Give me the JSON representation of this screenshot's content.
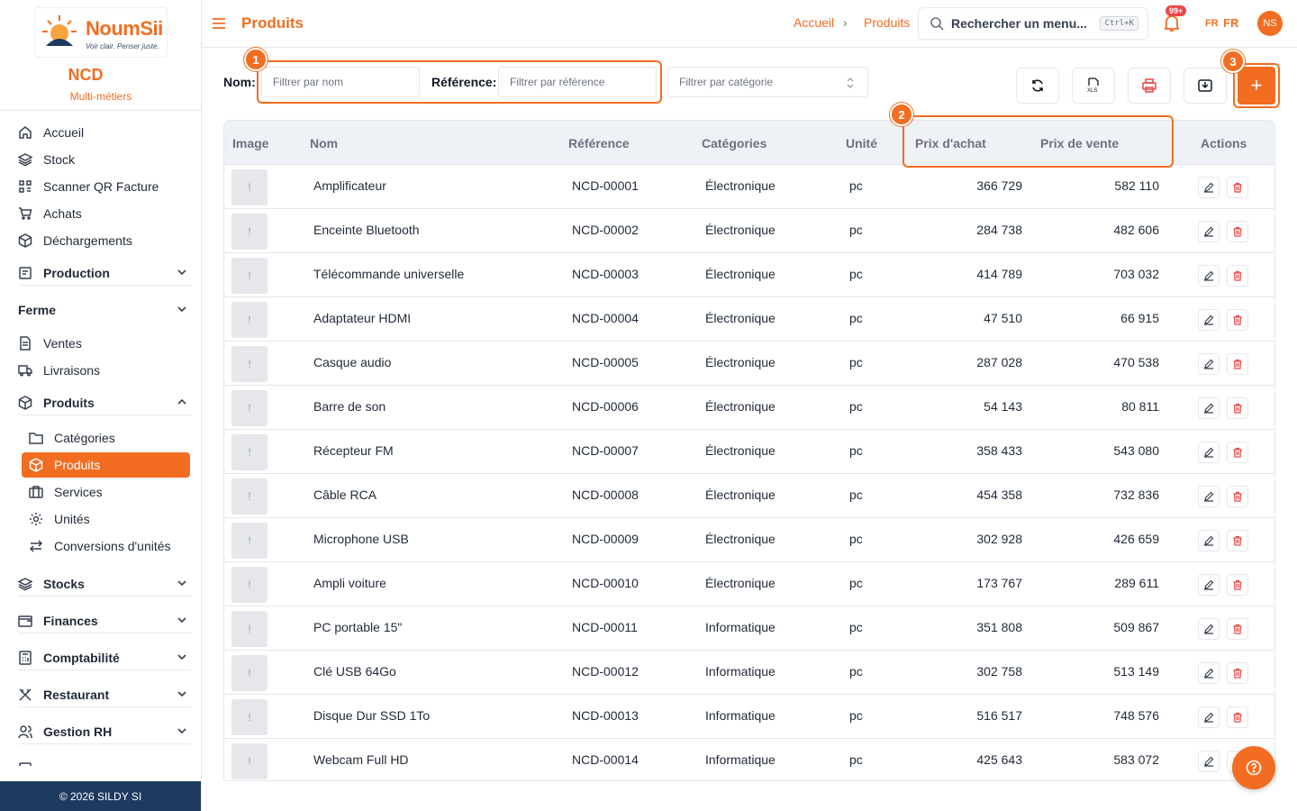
{
  "brand": {
    "logo_name": "NoumSii",
    "logo_tagline": "Voir clair. Penser juste.",
    "org_name": "NCD",
    "org_subtitle": "Multi-métiers",
    "accent_color": "#f26d21",
    "footer_bg": "#1e3a5f"
  },
  "sidebar": {
    "items": [
      {
        "label": "Accueil",
        "icon": "home-icon"
      },
      {
        "label": "Stock",
        "icon": "layers-icon"
      },
      {
        "label": "Scanner QR Facture",
        "icon": "qr-icon"
      },
      {
        "label": "Achats",
        "icon": "cart-icon"
      },
      {
        "label": "Déchargements",
        "icon": "box-icon"
      }
    ],
    "group_production": "Production",
    "group_ferme": "Ferme",
    "item_ventes": "Ventes",
    "item_livraisons": "Livraisons",
    "group_produits": "Produits",
    "sub_items": [
      {
        "label": "Catégories",
        "icon": "folder-icon"
      },
      {
        "label": "Produits",
        "icon": "box-icon",
        "active": true
      },
      {
        "label": "Services",
        "icon": "briefcase-icon"
      },
      {
        "label": "Unités",
        "icon": "gear-icon"
      },
      {
        "label": "Conversions d'unités",
        "icon": "swap-icon"
      }
    ],
    "groups_bottom": [
      "Stocks",
      "Finances",
      "Comptabilité",
      "Restaurant",
      "Gestion RH"
    ],
    "footer": "© 2026 SILDY SI"
  },
  "header": {
    "title": "Produits",
    "breadcrumb_home": "Accueil",
    "breadcrumb_sep": "›",
    "breadcrumb_current": "Produits",
    "search_placeholder": "Rechercher un menu...",
    "search_shortcut": "Ctrl+K",
    "notif_badge": "99+",
    "lang_flag": "FR",
    "lang": "FR",
    "avatar_initials": "NS"
  },
  "filters": {
    "name_label": "Nom:",
    "name_placeholder": "Filtrer par nom",
    "ref_label": "Référence:",
    "ref_placeholder": "Filtrer par référence",
    "category_placeholder": "Filtrer par catégorie"
  },
  "toolbar": {
    "add_label": "+"
  },
  "annotations": {
    "one": "1",
    "two": "2",
    "three": "3"
  },
  "table": {
    "headers": {
      "image": "Image",
      "name": "Nom",
      "reference": "Référence",
      "category": "Catégories",
      "unit": "Unité",
      "purchase": "Prix d'achat",
      "sale": "Prix de vente",
      "actions": "Actions"
    },
    "image_placeholder": "!",
    "rows": [
      {
        "name": "Amplificateur",
        "ref": "NCD-00001",
        "cat": "Électronique",
        "unit": "pc",
        "purchase": "366 729",
        "sale": "582 110"
      },
      {
        "name": "Enceinte Bluetooth",
        "ref": "NCD-00002",
        "cat": "Électronique",
        "unit": "pc",
        "purchase": "284 738",
        "sale": "482 606"
      },
      {
        "name": "Télécommande universelle",
        "ref": "NCD-00003",
        "cat": "Électronique",
        "unit": "pc",
        "purchase": "414 789",
        "sale": "703 032"
      },
      {
        "name": "Adaptateur HDMI",
        "ref": "NCD-00004",
        "cat": "Électronique",
        "unit": "pc",
        "purchase": "47 510",
        "sale": "66 915"
      },
      {
        "name": "Casque audio",
        "ref": "NCD-00005",
        "cat": "Électronique",
        "unit": "pc",
        "purchase": "287 028",
        "sale": "470 538"
      },
      {
        "name": "Barre de son",
        "ref": "NCD-00006",
        "cat": "Électronique",
        "unit": "pc",
        "purchase": "54 143",
        "sale": "80 811"
      },
      {
        "name": "Récepteur FM",
        "ref": "NCD-00007",
        "cat": "Électronique",
        "unit": "pc",
        "purchase": "358 433",
        "sale": "543 080"
      },
      {
        "name": "Câble RCA",
        "ref": "NCD-00008",
        "cat": "Électronique",
        "unit": "pc",
        "purchase": "454 358",
        "sale": "732 836"
      },
      {
        "name": "Microphone USB",
        "ref": "NCD-00009",
        "cat": "Électronique",
        "unit": "pc",
        "purchase": "302 928",
        "sale": "426 659"
      },
      {
        "name": "Ampli voiture",
        "ref": "NCD-00010",
        "cat": "Électronique",
        "unit": "pc",
        "purchase": "173 767",
        "sale": "289 611"
      },
      {
        "name": "PC portable 15\"",
        "ref": "NCD-00011",
        "cat": "Informatique",
        "unit": "pc",
        "purchase": "351 808",
        "sale": "509 867"
      },
      {
        "name": "Clé USB 64Go",
        "ref": "NCD-00012",
        "cat": "Informatique",
        "unit": "pc",
        "purchase": "302 758",
        "sale": "513 149"
      },
      {
        "name": "Disque Dur SSD 1To",
        "ref": "NCD-00013",
        "cat": "Informatique",
        "unit": "pc",
        "purchase": "516 517",
        "sale": "748 576"
      },
      {
        "name": "Webcam Full HD",
        "ref": "NCD-00014",
        "cat": "Informatique",
        "unit": "pc",
        "purchase": "425 643",
        "sale": "583 072"
      }
    ]
  }
}
